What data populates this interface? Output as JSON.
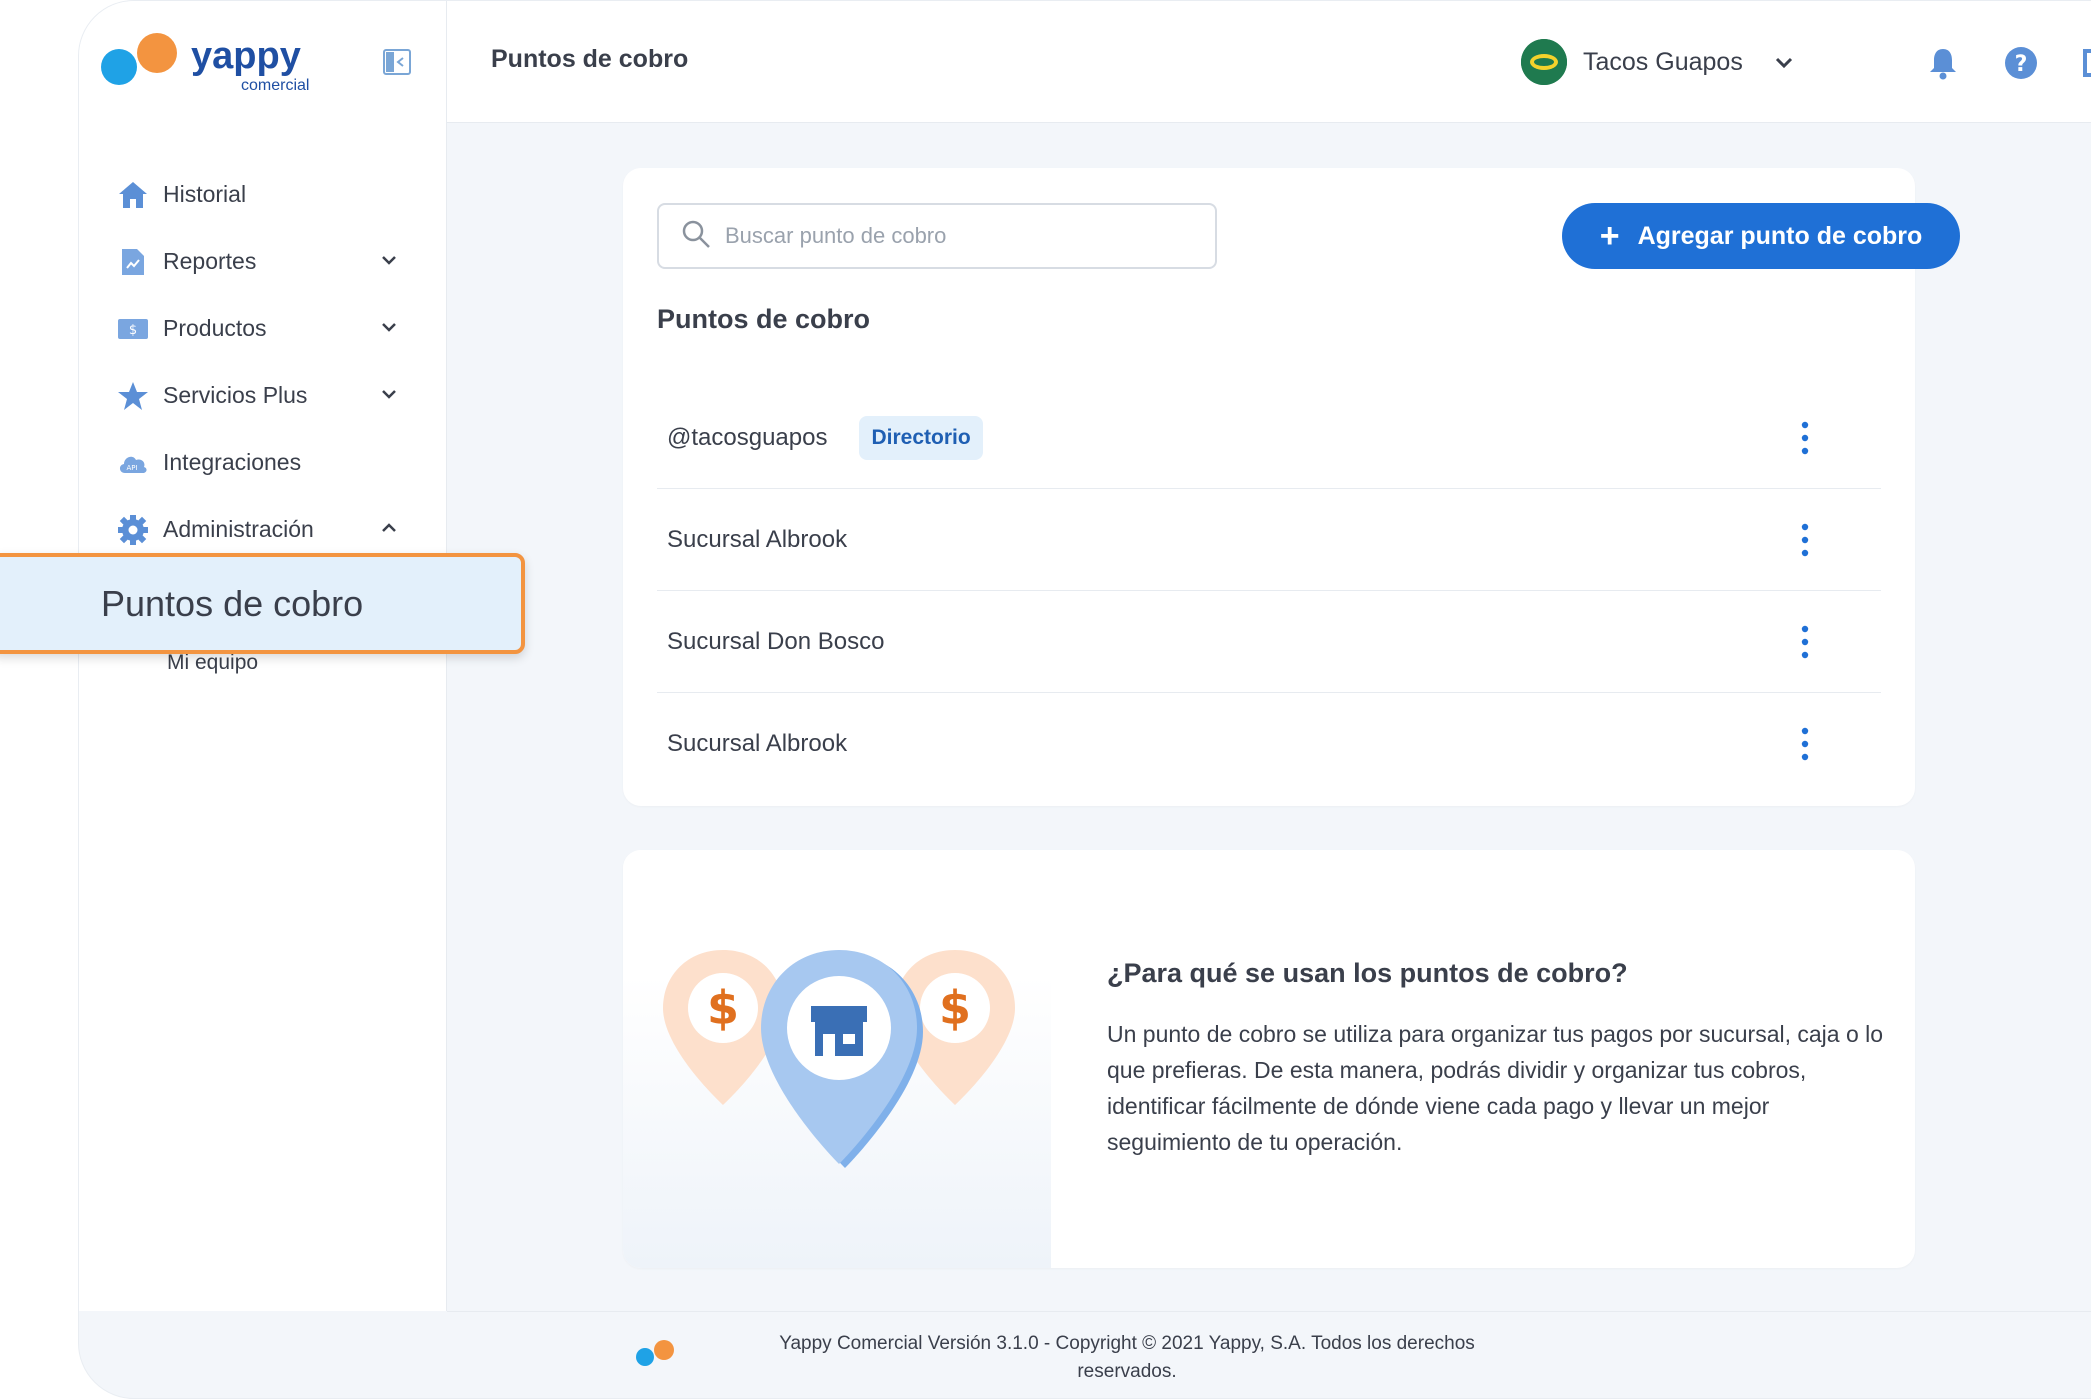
{
  "brand": {
    "name": "yappy",
    "sub": "comercial"
  },
  "header": {
    "title": "Puntos de cobro",
    "merchant": "Tacos Guapos",
    "merchant_avatar": "Tacos Guapos"
  },
  "sidebar": {
    "items": [
      {
        "label": "Historial",
        "icon": "home-icon"
      },
      {
        "label": "Reportes",
        "icon": "report-icon"
      },
      {
        "label": "Productos",
        "icon": "dollar-tag-icon"
      },
      {
        "label": "Servicios Plus",
        "icon": "star-icon"
      },
      {
        "label": "Integraciones",
        "icon": "api-cloud-icon"
      },
      {
        "label": "Administración",
        "icon": "gear-icon"
      }
    ],
    "active_sub": "Puntos de cobro",
    "sub_item": "Mi equipo"
  },
  "main": {
    "search_placeholder": "Buscar punto de cobro",
    "add_button": "Agregar punto de cobro",
    "section_title": "Puntos de cobro",
    "points": [
      {
        "name": "@tacosguapos",
        "badge": "Directorio"
      },
      {
        "name": "Sucursal Albrook"
      },
      {
        "name": "Sucursal Don Bosco"
      },
      {
        "name": "Sucursal Albrook"
      }
    ],
    "info_title": "¿Para qué se usan los puntos de cobro?",
    "info_text": "Un punto de cobro se utiliza para organizar tus pagos por sucursal, caja o lo que prefieras. De esta manera, podrás dividir y organizar tus cobros, identificar fácilmente de dónde viene cada pago y llevar un mejor seguimiento de tu operación."
  },
  "footer": {
    "text": "Yappy Comercial Versión 3.1.0  -  Copyright © 2021 Yappy, S.A. Todos los derechos reservados."
  },
  "colors": {
    "primary": "#1f70d6",
    "accent": "#f39440",
    "brand_blue": "#1f4fa3"
  }
}
